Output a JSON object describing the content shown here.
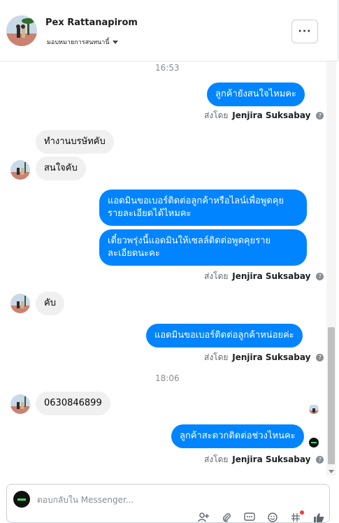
{
  "header": {
    "contact_name": "Pex Rattanapirom",
    "assign_label": "มอบหมายการสนทนานี้",
    "more_label": "···"
  },
  "messages": {
    "time_1": "16:53",
    "m1": "ลูกค้ายังสนใจไหมคะ",
    "sent_prefix": "ส่งโดย",
    "sent_by": "Jenjira Suksabay",
    "help_glyph": "?",
    "r1": "ทำงานบรษัทคับ",
    "r2": "สนใจคับ",
    "m2": "แอดมินขอเบอร์ติดต่อลูกค้าหรือไลน์เพื่อพูดคุยรายละเอียดได้ไหมคะ",
    "m3": "เดี๋ยวพรุ่งนี้แอดมินให้เซลล์ติดต่อพูดคุยรายละเอียดนะคะ",
    "r3": "คับ",
    "m4": "แอดมินขอเบอร์ติดต่อลูกค้าหน่อยค่ะ",
    "time_2": "18:06",
    "r4": "0630846899",
    "m5": "ลูกค้าสะดวกติดต่อช่วงไหนคะ"
  },
  "composer": {
    "placeholder": "ตอบกลับใน Messenger...",
    "tools": [
      "person-add-icon",
      "attachment-icon",
      "saved-replies-icon",
      "emoji-icon",
      "tag-icon",
      "like-icon"
    ]
  },
  "colors": {
    "outgoing_bubble": "#0084ff",
    "incoming_bubble": "#f0f0f0",
    "notification_dot": "#fa383e"
  }
}
